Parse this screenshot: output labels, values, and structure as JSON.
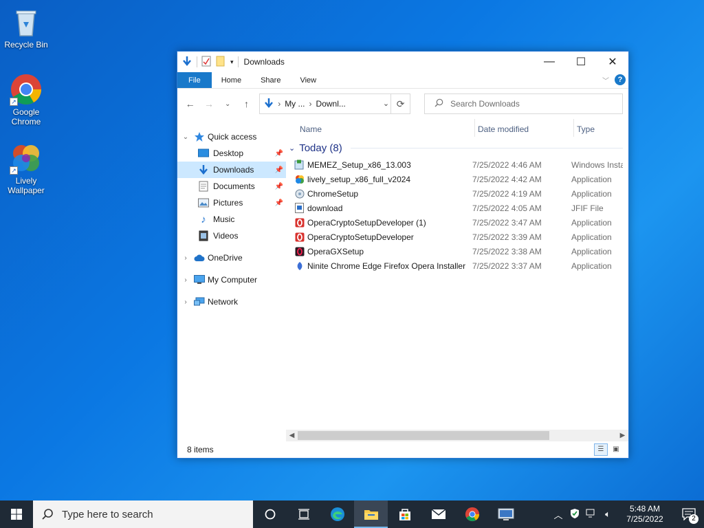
{
  "desktop": {
    "icons": [
      {
        "label": "Recycle Bin"
      },
      {
        "label": "Google Chrome"
      },
      {
        "label": "Lively Wallpaper"
      }
    ]
  },
  "window": {
    "title": "Downloads",
    "ribbon_tabs": [
      "File",
      "Home",
      "Share",
      "View"
    ],
    "help": "?",
    "address": {
      "seg1": "My ...",
      "seg2": "Downl..."
    },
    "search_placeholder": "Search Downloads",
    "nav": {
      "quick_access": "Quick access",
      "items": [
        "Desktop",
        "Downloads",
        "Documents",
        "Pictures",
        "Music",
        "Videos"
      ],
      "onedrive": "OneDrive",
      "my_computer": "My Computer",
      "network": "Network"
    },
    "columns": {
      "name": "Name",
      "date": "Date modified",
      "type": "Type"
    },
    "group": "Today (8)",
    "files": [
      {
        "name": "MEMEZ_Setup_x86_13.003",
        "date": "7/25/2022 4:46 AM",
        "type": "Windows Insta"
      },
      {
        "name": "lively_setup_x86_full_v2024",
        "date": "7/25/2022 4:42 AM",
        "type": "Application"
      },
      {
        "name": "ChromeSetup",
        "date": "7/25/2022 4:19 AM",
        "type": "Application"
      },
      {
        "name": "download",
        "date": "7/25/2022 4:05 AM",
        "type": "JFIF File"
      },
      {
        "name": "OperaCryptoSetupDeveloper (1)",
        "date": "7/25/2022 3:47 AM",
        "type": "Application"
      },
      {
        "name": "OperaCryptoSetupDeveloper",
        "date": "7/25/2022 3:39 AM",
        "type": "Application"
      },
      {
        "name": "OperaGXSetup",
        "date": "7/25/2022 3:38 AM",
        "type": "Application"
      },
      {
        "name": "Ninite Chrome Edge Firefox Opera Installer",
        "date": "7/25/2022 3:37 AM",
        "type": "Application"
      }
    ],
    "status": "8 items"
  },
  "taskbar": {
    "search_placeholder": "Type here to search",
    "time": "5:48 AM",
    "date": "7/25/2022",
    "notifications": "2"
  },
  "colors": {
    "accent": "#1979ca",
    "selected": "#cce8ff",
    "taskbar": "#1f2a36"
  }
}
